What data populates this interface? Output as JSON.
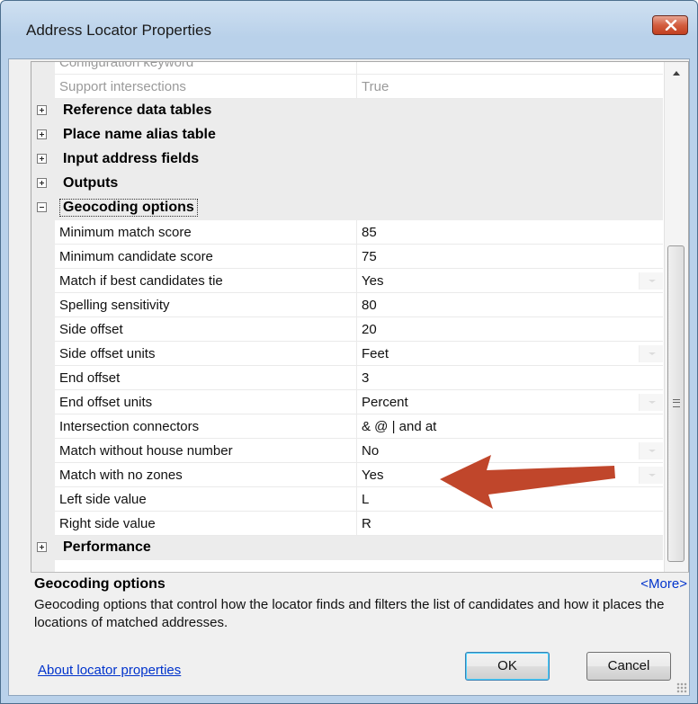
{
  "window": {
    "title": "Address Locator Properties"
  },
  "grid": {
    "top_rows": [
      {
        "label": "Configuration keyword",
        "value": ""
      },
      {
        "label": "Support intersections",
        "value": "True"
      }
    ],
    "categories": [
      {
        "label": "Reference data tables"
      },
      {
        "label": "Place name alias table"
      },
      {
        "label": "Input address fields"
      },
      {
        "label": "Outputs"
      },
      {
        "label": "Geocoding options"
      }
    ],
    "geocoding_options": [
      {
        "label": "Minimum match score",
        "value": "85"
      },
      {
        "label": "Minimum candidate score",
        "value": "75"
      },
      {
        "label": "Match if best candidates tie",
        "value": "Yes"
      },
      {
        "label": "Spelling sensitivity",
        "value": "80"
      },
      {
        "label": "Side offset",
        "value": "20"
      },
      {
        "label": "Side offset units",
        "value": "Feet"
      },
      {
        "label": "End offset",
        "value": "3"
      },
      {
        "label": "End offset units",
        "value": "Percent"
      },
      {
        "label": "Intersection connectors",
        "value": "& @ | and at"
      },
      {
        "label": "Match without house number",
        "value": "No"
      },
      {
        "label": "Match with no zones",
        "value": "Yes"
      },
      {
        "label": "Left side value",
        "value": "L"
      },
      {
        "label": "Right side value",
        "value": "R"
      }
    ],
    "last_category": {
      "label": "Performance"
    }
  },
  "description": {
    "title": "Geocoding options",
    "more": "<More>",
    "text": "Geocoding options that control how the locator finds and filters the list of candidates and how it places the locations of matched addresses."
  },
  "footer": {
    "about_link": "About locator properties",
    "ok_label": "OK",
    "cancel_label": "Cancel"
  },
  "colors": {
    "annotation_arrow": "#c0462b",
    "link": "#0033cc"
  }
}
